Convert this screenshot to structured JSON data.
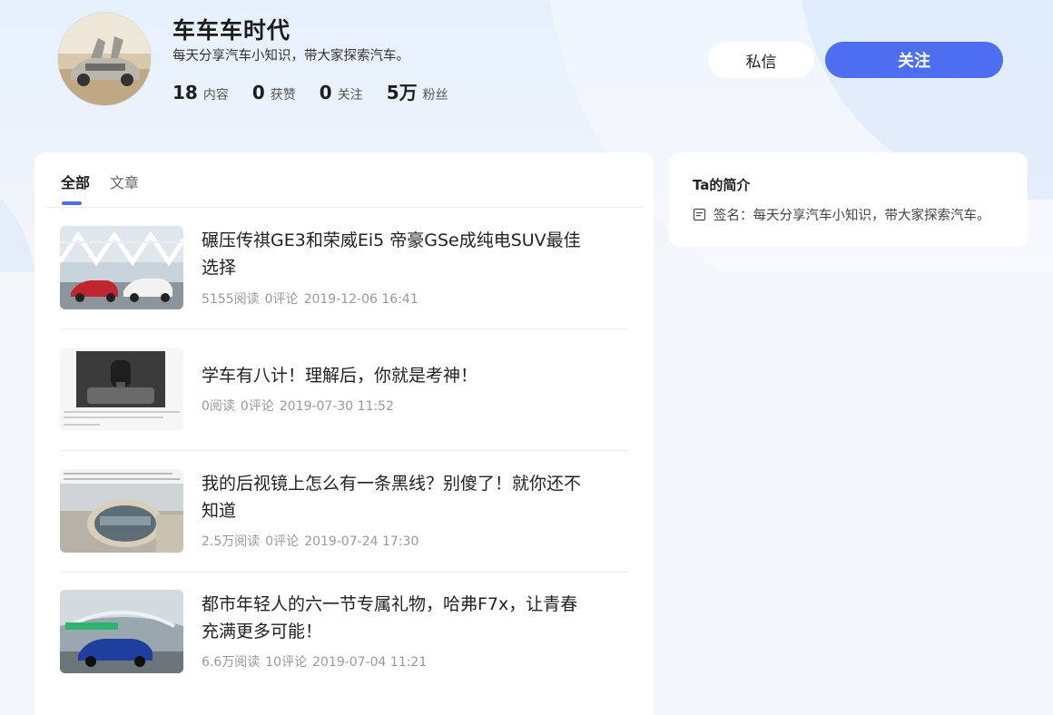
{
  "profile": {
    "name": "车车车时代",
    "signature": "每天分享汽车小知识，带大家探索汽车。",
    "stats": [
      {
        "num": "18",
        "label": "内容"
      },
      {
        "num": "0",
        "label": "获赞"
      },
      {
        "num": "0",
        "label": "关注"
      },
      {
        "num": "5万",
        "label": "粉丝"
      }
    ]
  },
  "actions": {
    "message_label": "私信",
    "follow_label": "关注"
  },
  "tabs": [
    {
      "label": "全部",
      "active": true
    },
    {
      "label": "文章",
      "active": false
    }
  ],
  "articles": [
    {
      "title": "碾压传祺GE3和荣威Ei5 帝豪GSe成纯电SUV最佳选择",
      "reads": "5155阅读",
      "comments": "0评论",
      "time": "2019-12-06 16:41"
    },
    {
      "title": "学车有八计！理解后，你就是考神！",
      "reads": "0阅读",
      "comments": "0评论",
      "time": "2019-07-30 11:52"
    },
    {
      "title": "我的后视镜上怎么有一条黑线？别傻了！就你还不知道",
      "reads": "2.5万阅读",
      "comments": "0评论",
      "time": "2019-07-24 17:30"
    },
    {
      "title": "都市年轻人的六一节专属礼物，哈弗F7x，让青春充满更多可能！",
      "reads": "6.6万阅读",
      "comments": "10评论",
      "time": "2019-07-04 11:21"
    }
  ],
  "sidebar": {
    "title": "Ta的简介",
    "signature": "签名：每天分享汽车小知识，带大家探索汽车。"
  },
  "colors": {
    "accent": "#4e6ef2",
    "background": "#f4f6fa"
  }
}
